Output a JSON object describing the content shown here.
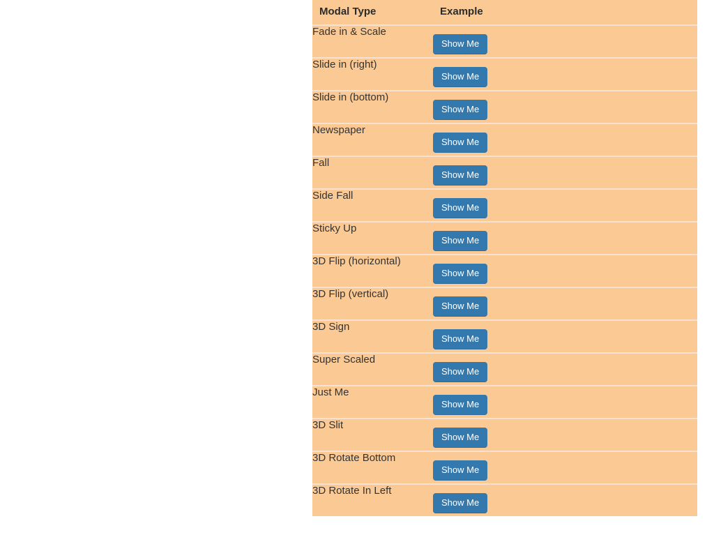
{
  "table": {
    "columns": [
      {
        "key": "modal_type",
        "label": "Modal Type"
      },
      {
        "key": "example",
        "label": "Example"
      }
    ],
    "button_label": "Show Me",
    "rows": [
      {
        "modal_type": "Fade in & Scale",
        "example": "Show Me"
      },
      {
        "modal_type": "Slide in (right)",
        "example": "Show Me"
      },
      {
        "modal_type": "Slide in (bottom)",
        "example": "Show Me"
      },
      {
        "modal_type": "Newspaper",
        "example": "Show Me"
      },
      {
        "modal_type": "Fall",
        "example": "Show Me"
      },
      {
        "modal_type": "Side Fall",
        "example": "Show Me"
      },
      {
        "modal_type": "Sticky Up",
        "example": "Show Me"
      },
      {
        "modal_type": "3D Flip (horizontal)",
        "example": "Show Me"
      },
      {
        "modal_type": "3D Flip (vertical)",
        "example": "Show Me"
      },
      {
        "modal_type": "3D Sign",
        "example": "Show Me"
      },
      {
        "modal_type": "Super Scaled",
        "example": "Show Me"
      },
      {
        "modal_type": "Just Me",
        "example": "Show Me"
      },
      {
        "modal_type": "3D Slit",
        "example": "Show Me"
      },
      {
        "modal_type": "3D Rotate Bottom",
        "example": "Show Me"
      },
      {
        "modal_type": "3D Rotate In Left",
        "example": "Show Me"
      }
    ]
  },
  "colors": {
    "page_background": "#ffffff",
    "table_background": "#fbc994",
    "row_separator": "#f7e2d1",
    "button_background": "#3479ae",
    "button_text": "#ffffff",
    "header_text": "#2b2b2b",
    "body_text": "#333333"
  }
}
